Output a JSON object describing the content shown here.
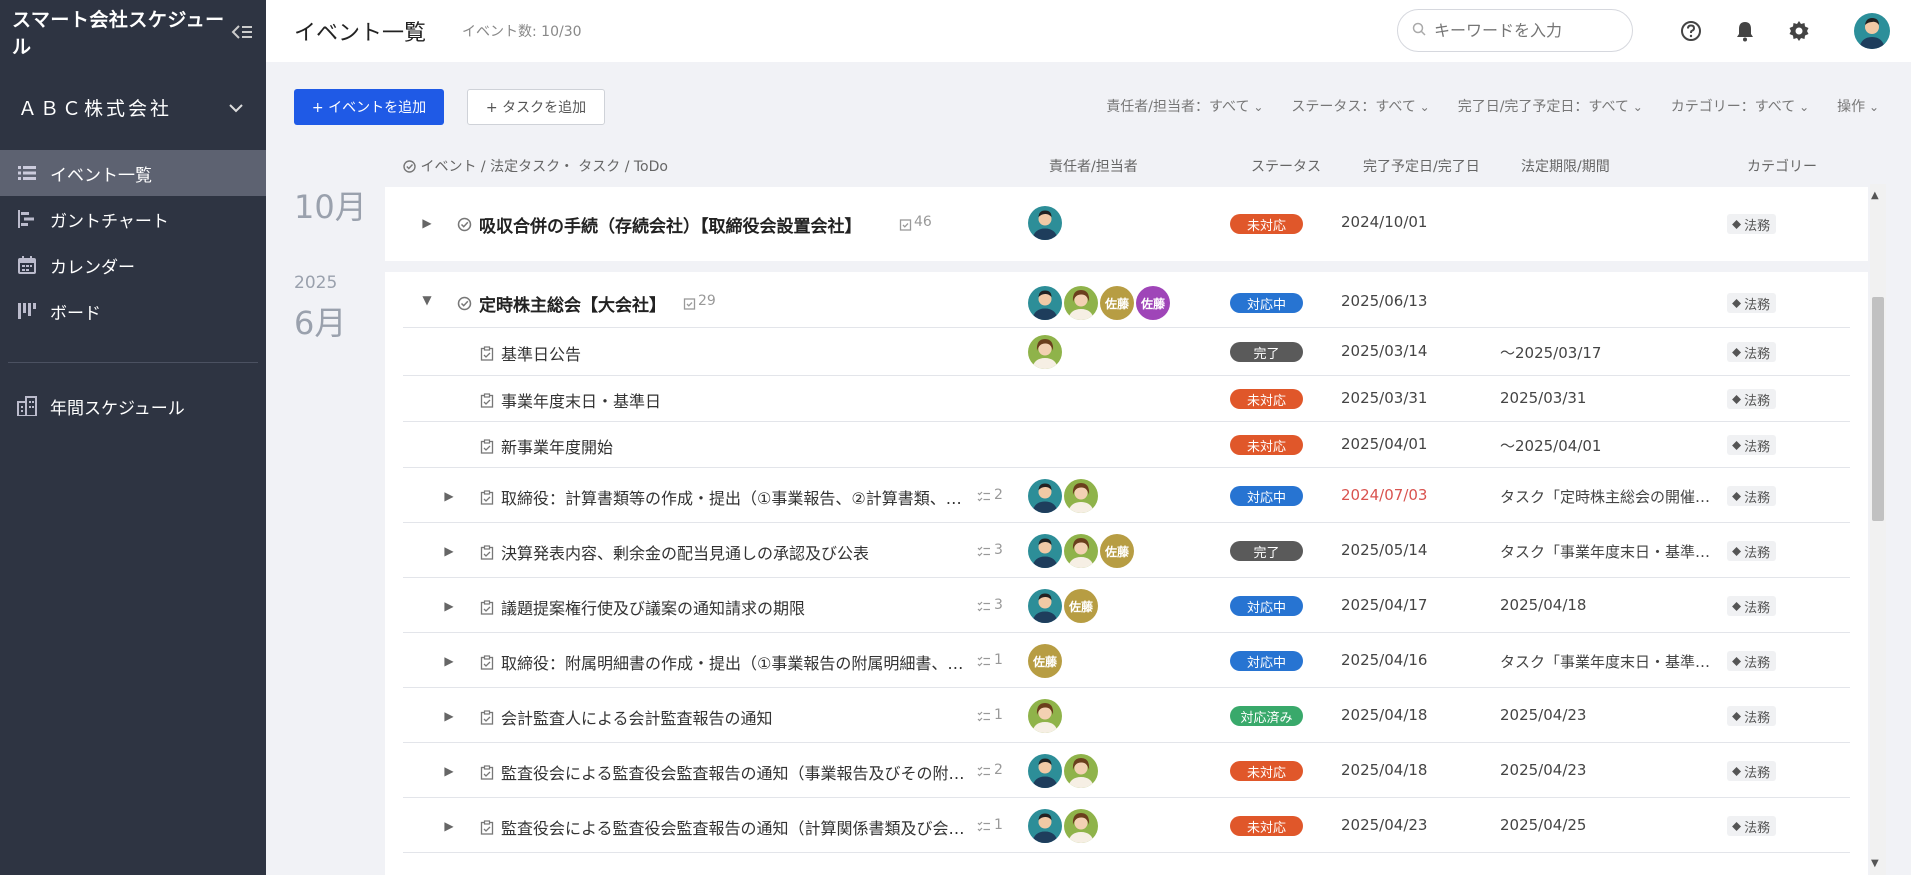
{
  "sidebar": {
    "app_title": "スマート会社スケジュール",
    "company": "ＡＢＣ株式会社",
    "nav": [
      {
        "label": "イベント一覧",
        "icon": "list-icon"
      },
      {
        "label": "ガントチャート",
        "icon": "gantt-icon"
      },
      {
        "label": "カレンダー",
        "icon": "calendar-icon"
      },
      {
        "label": "ボード",
        "icon": "board-icon"
      }
    ],
    "annual": {
      "label": "年間スケジュール",
      "icon": "building-icon"
    }
  },
  "header": {
    "title": "イベント一覧",
    "count": "イベント数: 10/30",
    "search_placeholder": "キーワードを入力"
  },
  "actions": {
    "add_event": "+ イベントを追加",
    "add_task": "+ タスクを追加",
    "filters": [
      "責任者/担当者：すべて",
      "ステータス：すべて",
      "完了日/完了予定日：すべて",
      "カテゴリー：すべて",
      "操作"
    ]
  },
  "columns": {
    "type": "イベント / 法定タスク・ タスク / ToDo",
    "owner": "責任者/担当者",
    "status": "ステータス",
    "due": "完了予定日/完了日",
    "legal": "法定期限/期間",
    "category": "カテゴリー"
  },
  "groups": {
    "g1": {
      "month": "10月"
    },
    "g2": {
      "year": "2025",
      "month": "6月"
    }
  },
  "rows": [
    {
      "title": "吸収合併の手続（存続会社）【取締役会設置会社】",
      "count": "46",
      "avatars": [
        "p1"
      ],
      "status": "未対応",
      "due": "2024/10/01",
      "legal": "",
      "category": "法務"
    },
    {
      "title": "定時株主総会【大会社】",
      "count": "29",
      "avatars": [
        "p1",
        "p2",
        "佐藤",
        "佐藤"
      ],
      "status": "対応中",
      "due": "2025/06/13",
      "legal": "",
      "category": "法務"
    },
    {
      "title": "基準日公告",
      "count": "",
      "avatars": [
        "p2"
      ],
      "status": "完了",
      "due": "2025/03/14",
      "legal": "～2025/03/17",
      "category": "法務"
    },
    {
      "title": "事業年度末日・基準日",
      "count": "",
      "avatars": [],
      "status": "未対応",
      "due": "2025/03/31",
      "legal": "2025/03/31",
      "category": "法務"
    },
    {
      "title": "新事業年度開始",
      "count": "",
      "avatars": [],
      "status": "未対応",
      "due": "2025/04/01",
      "legal": "～2025/04/01",
      "category": "法務"
    },
    {
      "title": "取締役：計算書類等の作成・提出（①事業報告、②計算書類、③…",
      "count": "2",
      "avatars": [
        "p1",
        "p2"
      ],
      "status": "対応中",
      "due": "2024/07/03",
      "legal": "タスク「定時株主総会の開催…",
      "category": "法務"
    },
    {
      "title": "決算発表内容、剰余金の配当見通しの承認及び公表",
      "count": "3",
      "avatars": [
        "p1",
        "p2",
        "佐藤"
      ],
      "status": "完了",
      "due": "2025/05/14",
      "legal": "タスク「事業年度末日・基準…",
      "category": "法務"
    },
    {
      "title": "議題提案権行使及び議案の通知請求の期限",
      "count": "3",
      "avatars": [
        "p1",
        "佐藤"
      ],
      "status": "対応中",
      "due": "2025/04/17",
      "legal": "2025/04/18",
      "category": "法務"
    },
    {
      "title": "取締役：附属明細書の作成・提出（①事業報告の附属明細書、②…",
      "count": "1",
      "avatars": [
        "佐藤"
      ],
      "status": "対応中",
      "due": "2025/04/16",
      "legal": "タスク「事業年度末日・基準…",
      "category": "法務"
    },
    {
      "title": "会計監査人による会計監査報告の通知",
      "count": "1",
      "avatars": [
        "p2"
      ],
      "status": "対応済み",
      "due": "2025/04/18",
      "legal": "2025/04/23",
      "category": "法務"
    },
    {
      "title": "監査役会による監査役会監査報告の通知（事業報告及びその附属…",
      "count": "2",
      "avatars": [
        "p1",
        "p2"
      ],
      "status": "未対応",
      "due": "2025/04/18",
      "legal": "2025/04/23",
      "category": "法務"
    },
    {
      "title": "監査役会による監査役会監査報告の通知（計算関係書類及び会計…",
      "count": "1",
      "avatars": [
        "p1",
        "p2"
      ],
      "status": "未対応",
      "due": "2025/04/23",
      "legal": "2025/04/25",
      "category": "法務"
    }
  ]
}
